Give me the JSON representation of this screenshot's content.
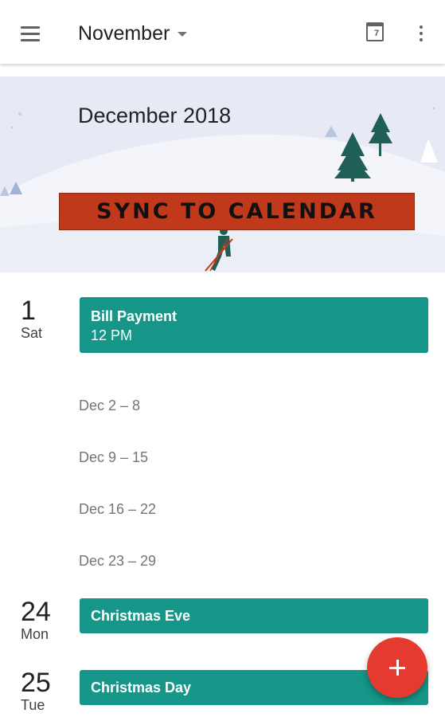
{
  "appbar": {
    "month_label": "November",
    "today_date": "7",
    "icons": {
      "menu": "menu-icon",
      "dropdown": "arrow-drop-down-icon",
      "today": "calendar-today-icon",
      "overflow": "more-vert-icon"
    }
  },
  "banner": {
    "title": "December 2018",
    "sync_label": "SYNC TO CALENDAR",
    "colors": {
      "background": "#e7eaf4",
      "sync_button": "#c0391b",
      "tree": "#1f5f56"
    }
  },
  "agenda": {
    "days": [
      {
        "num": "1",
        "name": "Sat",
        "event": {
          "title": "Bill Payment",
          "time": "12 PM"
        }
      },
      {
        "num": "24",
        "name": "Mon",
        "event": {
          "title": "Christmas Eve"
        }
      },
      {
        "num": "25",
        "name": "Tue",
        "event": {
          "title": "Christmas Day"
        }
      }
    ],
    "weeks": [
      "Dec 2 – 8",
      "Dec 9 – 15",
      "Dec 16 – 22",
      "Dec 23 – 29"
    ],
    "event_color": "#159688"
  },
  "fab": {
    "label": "+",
    "icon": "add-icon",
    "color": "#e53a2f"
  }
}
